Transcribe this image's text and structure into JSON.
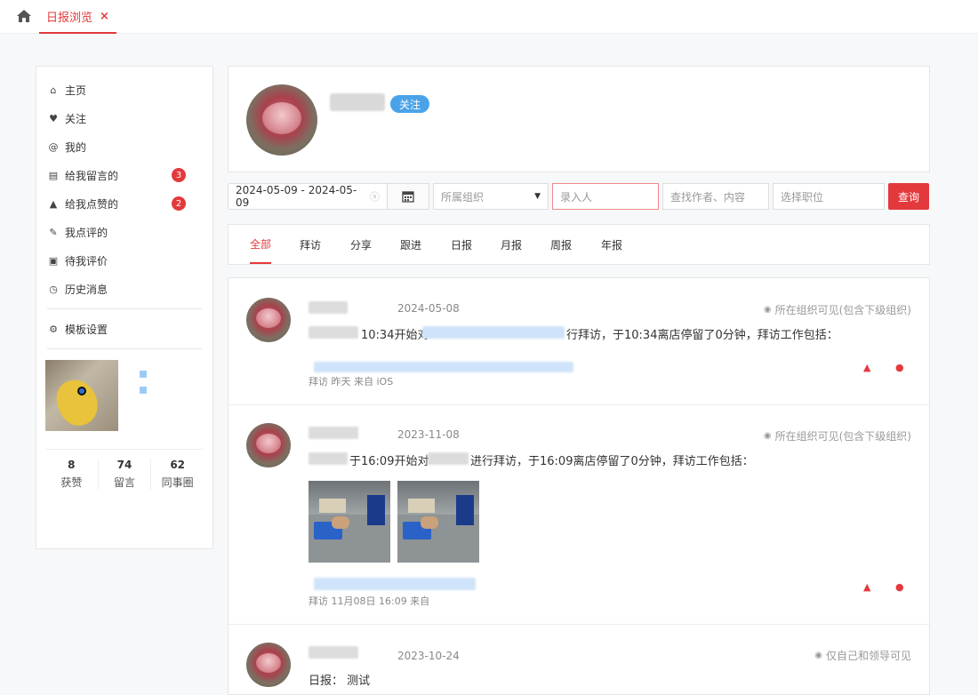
{
  "topbar": {
    "home_icon": "home-icon",
    "active_tab": "日报浏览",
    "close_glyph": "×"
  },
  "sidebar": {
    "items": [
      {
        "label": "主页",
        "icon": "home-icon",
        "glyph": "⌂"
      },
      {
        "label": "关注",
        "icon": "heart-icon",
        "glyph": "♥"
      },
      {
        "label": "我的",
        "icon": "at-icon",
        "glyph": "@"
      },
      {
        "label": "给我留言的",
        "icon": "comment-icon",
        "glyph": "▤",
        "badge": "3"
      },
      {
        "label": "给我点赞的",
        "icon": "thumb-up-icon",
        "glyph": "▲",
        "badge": "2"
      },
      {
        "label": "我点评的",
        "icon": "edit-icon",
        "glyph": "✎"
      },
      {
        "label": "待我评价",
        "icon": "doc-icon",
        "glyph": "▣"
      },
      {
        "label": "历史消息",
        "icon": "clock-icon",
        "glyph": "◷"
      }
    ],
    "settings": {
      "label": "模板设置",
      "icon": "gear-icon",
      "glyph": "⚙"
    },
    "stats": [
      {
        "num": "8",
        "label": "获赞"
      },
      {
        "num": "74",
        "label": "留言"
      },
      {
        "num": "62",
        "label": "同事圈"
      }
    ]
  },
  "profile": {
    "follow_label": "关注"
  },
  "filters": {
    "date_range": "2024-05-09 - 2024-05-09",
    "clear_glyph": "ⓧ",
    "org_placeholder": "所属组织",
    "recorder_placeholder": "录入人",
    "search_placeholder": "查找作者、内容",
    "position_placeholder": "选择职位",
    "query_label": "查询"
  },
  "categories": [
    "全部",
    "拜访",
    "分享",
    "跟进",
    "日报",
    "月报",
    "周报",
    "年报"
  ],
  "posts": [
    {
      "date": "2024-05-08",
      "visibility": "所在组织可见(包含下级组织)",
      "text_a": "10:34开始对",
      "text_b": "行拜访，于10:34离店停留了0分钟，拜访工作包括：",
      "meta": "拜访  昨天  来自 iOS"
    },
    {
      "date": "2023-11-08",
      "visibility": "所在组织可见(包含下级组织)",
      "text_a": "于16:09开始对",
      "text_b": "进行拜访，于16:09离店停留了0分钟，拜访工作包括：",
      "meta": "拜访  11月08日 16:09  来自"
    },
    {
      "date": "2023-10-24",
      "visibility": "仅自己和领导可见",
      "text_a": "日报：  测试"
    }
  ]
}
